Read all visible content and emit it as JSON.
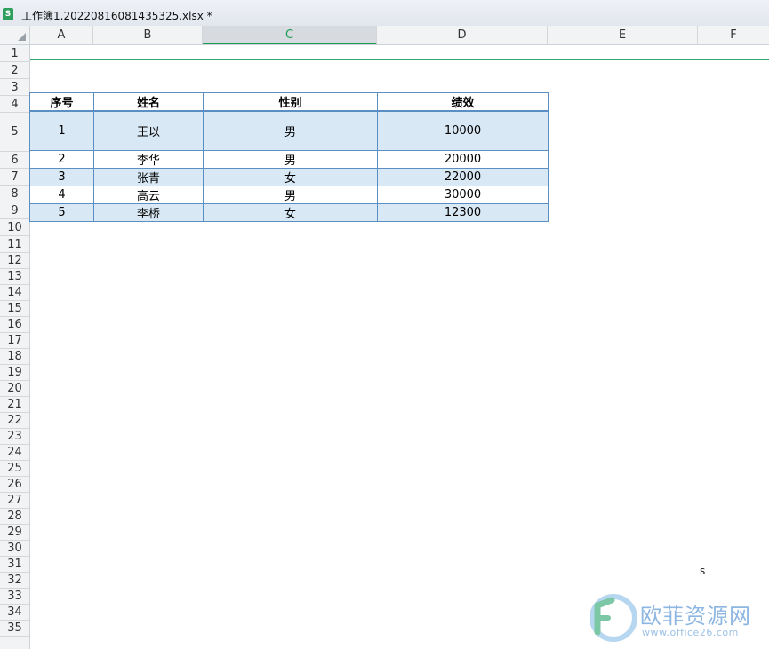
{
  "window": {
    "title": "工作簿1.20220816081435325.xlsx *",
    "file_icon_label": "S"
  },
  "columns": [
    "A",
    "B",
    "C",
    "D",
    "E",
    "F"
  ],
  "rows": [
    "1",
    "2",
    "3",
    "4",
    "5",
    "6",
    "7",
    "8",
    "9",
    "10",
    "11",
    "12",
    "13",
    "14",
    "15",
    "16",
    "17",
    "18",
    "19",
    "20",
    "21",
    "22",
    "23",
    "24",
    "25",
    "26",
    "27",
    "28",
    "29",
    "30",
    "31",
    "32",
    "33",
    "34",
    "35"
  ],
  "active_column": "C",
  "table": {
    "headers": [
      "序号",
      "姓名",
      "性别",
      "绩效"
    ],
    "rows": [
      [
        "1",
        "王以",
        "男",
        "10000"
      ],
      [
        "2",
        "李华",
        "男",
        "20000"
      ],
      [
        "3",
        "张青",
        "女",
        "22000"
      ],
      [
        "4",
        "高云",
        "男",
        "30000"
      ],
      [
        "5",
        "李桥",
        "女",
        "12300"
      ]
    ]
  },
  "stray_text": "s",
  "watermark": {
    "text": "欧菲资源网",
    "url": "www.office26.com"
  }
}
